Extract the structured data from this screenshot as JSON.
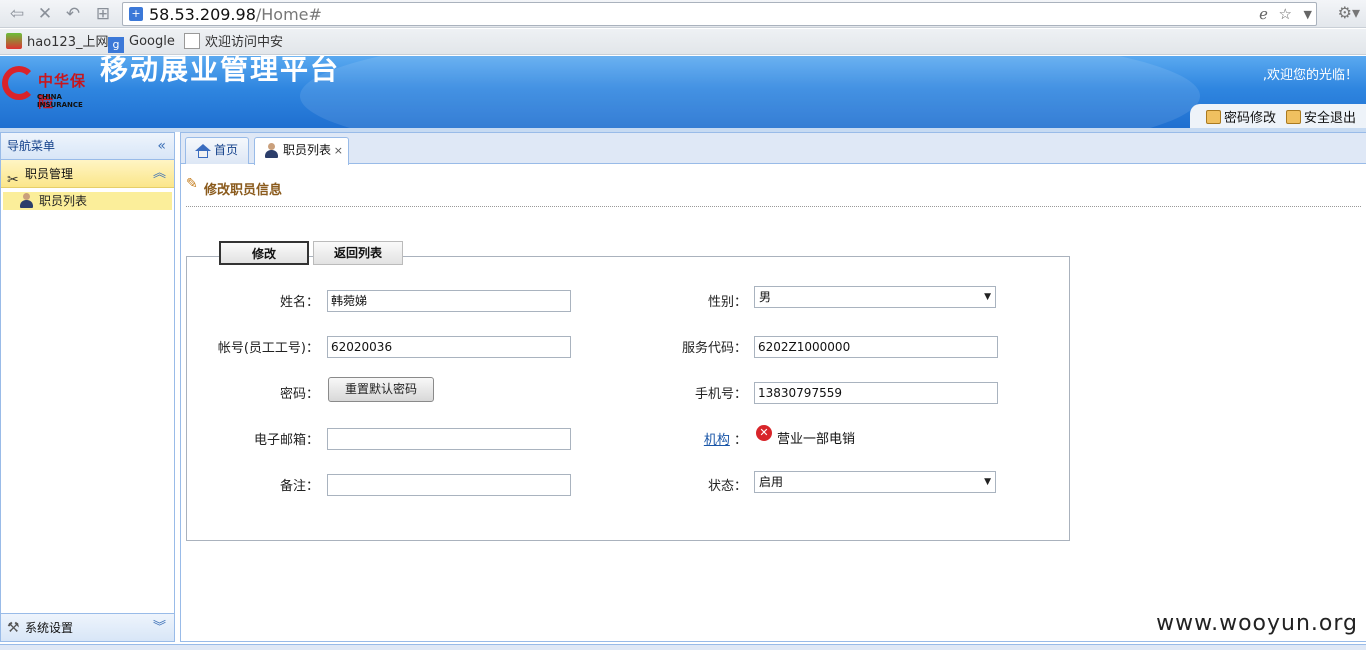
{
  "browser": {
    "url_host": "58.53.209.98",
    "url_path": "/Home#",
    "bookmarks": [
      {
        "label": "hao123_上网"
      },
      {
        "label": "Google"
      },
      {
        "label": "欢迎访问中安"
      }
    ]
  },
  "header": {
    "logo_cn": "中华保险",
    "logo_en": "CHINA INSURANCE",
    "app_title": "移动展业管理平台",
    "welcome": ",欢迎您的光临！",
    "change_password": "密码修改",
    "logout": "安全退出"
  },
  "sidebar": {
    "title": "导航菜单",
    "group": "职员管理",
    "items": [
      {
        "label": "职员列表"
      }
    ],
    "footer": "系统设置"
  },
  "tabs": [
    {
      "label": "首页"
    },
    {
      "label": "职员列表"
    }
  ],
  "page": {
    "title": "修改职员信息",
    "modify_button": "修改",
    "back_button": "返回列表"
  },
  "form": {
    "name_label": "姓名：",
    "name_value": "韩菀娣",
    "gender_label": "性别：",
    "gender_value": "男",
    "account_label": "帐号(员工工号)：",
    "account_value": "62020036",
    "service_code_label": "服务代码：",
    "service_code_value": "6202Z1000000",
    "password_label": "密码：",
    "reset_password_button": "重置默认密码",
    "mobile_label": "手机号：",
    "mobile_value": "13830797559",
    "email_label": "电子邮箱：",
    "email_value": "",
    "org_label": "机构",
    "org_colon": "：",
    "org_value": "营业一部电销",
    "remark_label": "备注：",
    "remark_value": "",
    "status_label": "状态：",
    "status_value": "启用"
  },
  "watermark": "www.wooyun.org",
  "colors": {
    "header_blue": "#2f86e0",
    "panel_border": "#99bbe8",
    "selected_yellow": "#fbee9a",
    "error_red": "#d8252a",
    "title_brown": "#8a5a1c"
  }
}
